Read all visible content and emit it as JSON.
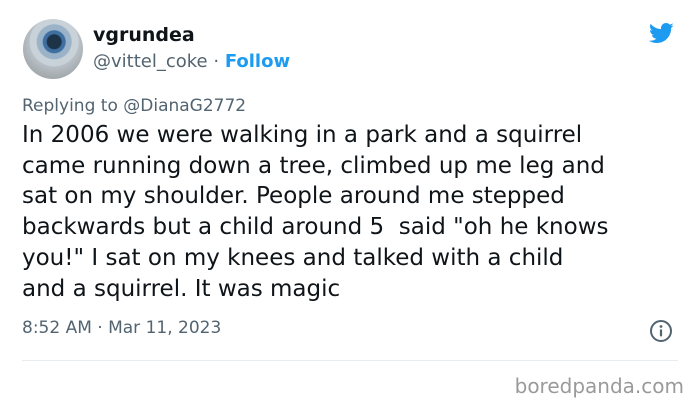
{
  "author": {
    "display_name": "vgrundea",
    "handle": "@vittel_coke",
    "separator": "·",
    "follow_label": "Follow"
  },
  "icons": {
    "avatar": "avatar-photo",
    "brand": "twitter-bird-icon",
    "info": "info-icon"
  },
  "reply": {
    "prefix": "Replying to ",
    "mention": "@DianaG2772"
  },
  "tweet": {
    "text": "In 2006 we were walking in a park and a squirrel\ncame running down a tree, climbed up me leg and\nsat on my shoulder. People around me stepped\nbackwards but a child around 5  said \"oh he knows\nyou!\" I sat on my knees and talked with a child\nand a squirrel. It was magic"
  },
  "meta": {
    "timestamp": "8:52 AM · Mar 11, 2023"
  },
  "watermark": {
    "text": "boredpanda.com"
  },
  "colors": {
    "accent": "#1d9bf0",
    "text": "#0f1419",
    "secondary": "#536471",
    "watermark": "#9a9a9a"
  }
}
